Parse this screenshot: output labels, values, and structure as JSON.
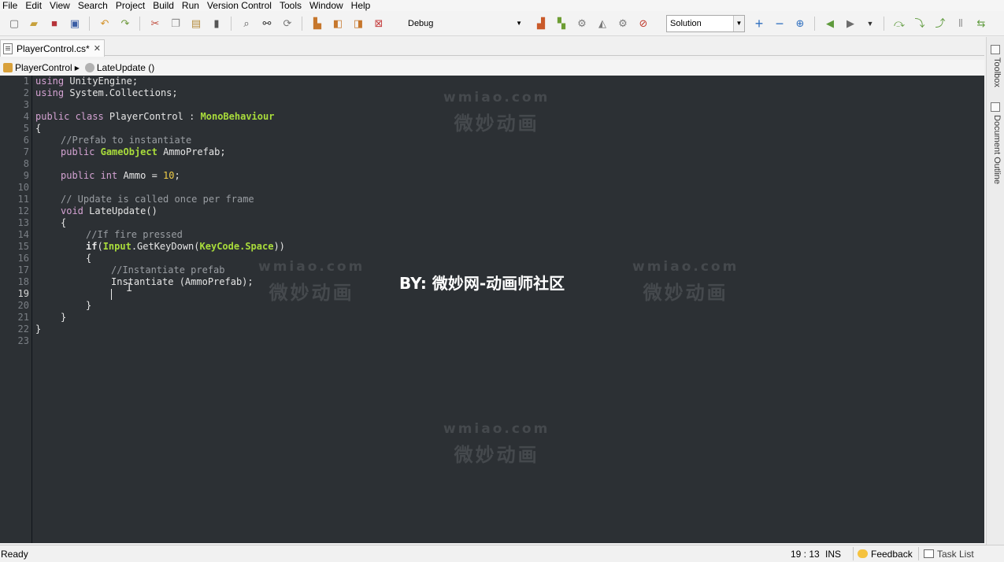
{
  "menu": [
    "File",
    "Edit",
    "View",
    "Search",
    "Project",
    "Build",
    "Run",
    "Version Control",
    "Tools",
    "Window",
    "Help"
  ],
  "toolbar": {
    "configuration": "Debug",
    "solution_selector": "Solution"
  },
  "tab": {
    "label": "PlayerControl.cs*",
    "close": "✕"
  },
  "breadcrumb": {
    "class_name": "PlayerControl",
    "method_name": "LateUpdate ()"
  },
  "editor": {
    "line_numbers": [
      "1",
      "2",
      "3",
      "4",
      "5",
      "6",
      "7",
      "8",
      "9",
      "10",
      "11",
      "12",
      "13",
      "14",
      "15",
      "16",
      "17",
      "18",
      "19",
      "20",
      "21",
      "22",
      "23"
    ],
    "current_line": "19",
    "code": {
      "l1_kw": "using",
      "l1_rest": " UnityEngine;",
      "l2_kw": "using",
      "l2_rest": " System.Collections;",
      "l4_kw": "public class",
      "l4_mid": " PlayerControl : ",
      "l4_type": "MonoBehaviour",
      "l5": "{",
      "l6_comment": "//Prefab to instantiate",
      "l7_kw": "public",
      "l7_type": "GameObject",
      "l7_rest": " AmmoPrefab;",
      "l9_kw": "public int",
      "l9_mid": " Ammo = ",
      "l9_num": "10",
      "l9_end": ";",
      "l11_comment": "// Update is called once per frame",
      "l12_kw": "void",
      "l12_rest": " LateUpdate()",
      "l13": "{",
      "l14_comment": "//If fire pressed",
      "l15_kw": "if",
      "l15_a": "(",
      "l15_type1": "Input",
      "l15_b": ".GetKeyDown(",
      "l15_type2": "KeyCode.Space",
      "l15_c": "))",
      "l16": "{",
      "l17_comment": "//Instantiate prefab",
      "l18": "Instantiate (AmmoPrefab);",
      "l20": "}",
      "l21": "}",
      "l22": "}"
    }
  },
  "watermarks": {
    "url": "wmiao.com",
    "cn": "微妙动画"
  },
  "credit": "BY: 微妙网-动画师社区",
  "side_panel": {
    "toolbox": "Toolbox",
    "document_outline": "Document Outline"
  },
  "status": {
    "ready": "Ready",
    "position": "19 : 13",
    "mode": "INS",
    "feedback": "Feedback",
    "task_list": "Task List"
  },
  "colors": {
    "editor_bg": "#2c3034",
    "keyword": "#d5a3d3",
    "type": "#a9dc3b",
    "comment": "#9a9ea3",
    "number": "#f0cd47"
  }
}
